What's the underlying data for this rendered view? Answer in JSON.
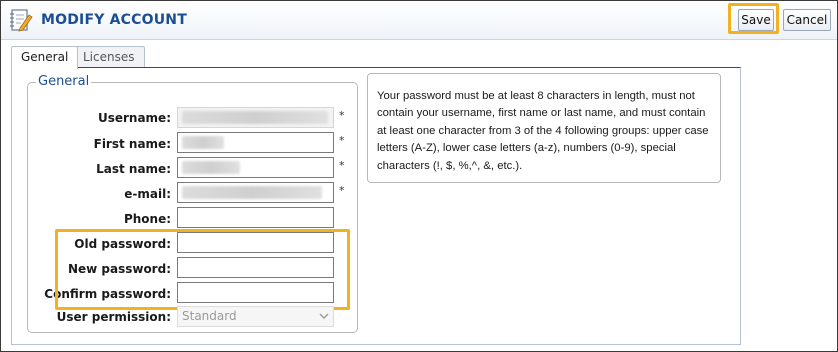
{
  "header": {
    "title": "MODIFY ACCOUNT",
    "app_icon": "edit-notepad-icon",
    "save_label": "Save",
    "cancel_label": "Cancel"
  },
  "tabs": [
    {
      "label": "General",
      "active": true
    },
    {
      "label": "Licenses",
      "active": false
    }
  ],
  "group": {
    "legend": "General"
  },
  "fields": {
    "username": {
      "label": "Username:",
      "value": "",
      "required": "*"
    },
    "first_name": {
      "label": "First name:",
      "value": "",
      "required": "*"
    },
    "last_name": {
      "label": "Last name:",
      "value": "",
      "required": "*"
    },
    "email": {
      "label": "e-mail:",
      "value": "",
      "required": "*"
    },
    "phone": {
      "label": "Phone:",
      "value": ""
    },
    "old_password": {
      "label": "Old password:",
      "value": ""
    },
    "new_password": {
      "label": "New password:",
      "value": ""
    },
    "confirm_password": {
      "label": "Confirm password:",
      "value": ""
    },
    "user_permission": {
      "label": "User permission:",
      "selected": "Standard"
    }
  },
  "info": {
    "text": "Your password must be at least 8 characters in length, must not contain your username, first name or last name, and must contain at least one character from 3 of the 4 following groups: upper case letters (A-Z), lower case letters (a-z), numbers (0-9), special characters (!, $, %,^, &, etc.)."
  },
  "colors": {
    "accent": "#1b4f91",
    "highlight": "#f2b11f"
  }
}
